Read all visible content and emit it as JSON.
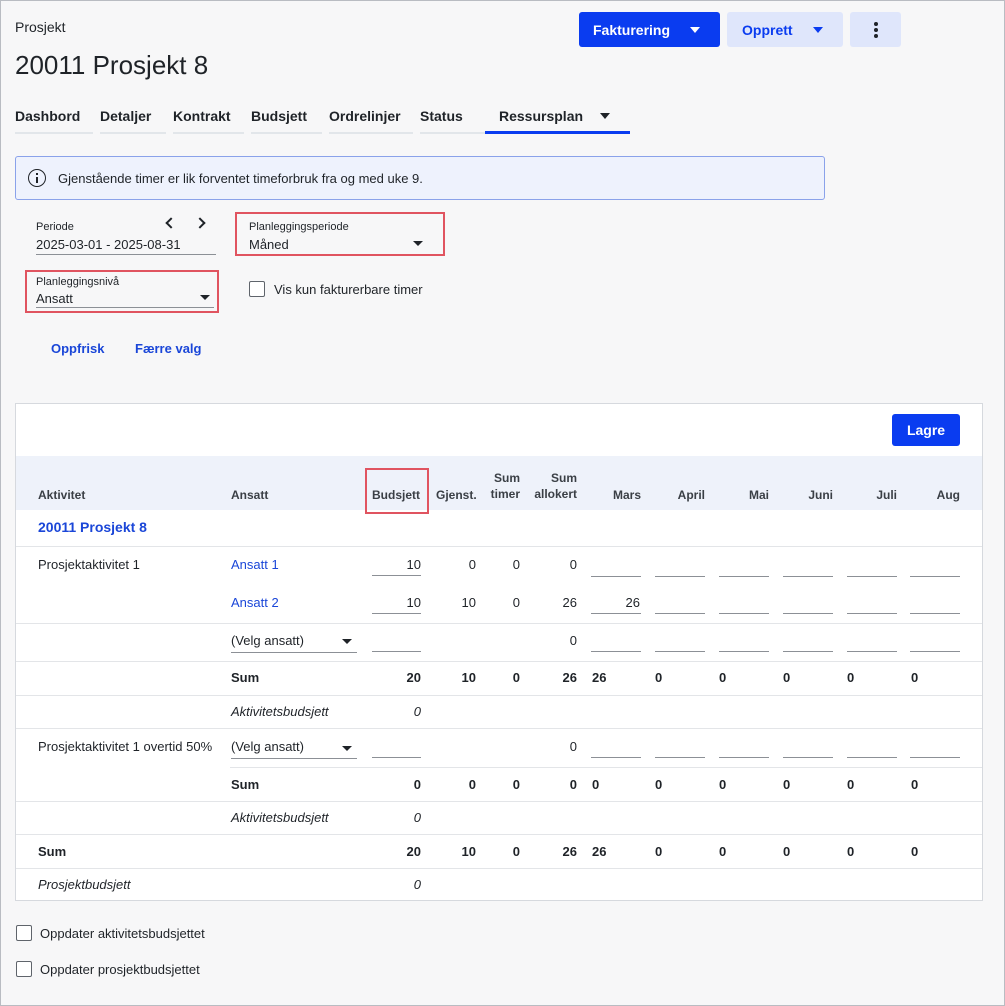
{
  "header": {
    "kicker": "Prosjekt",
    "title": "20011 Prosjekt 8",
    "primary_action": "Fakturering",
    "secondary_action": "Opprett"
  },
  "tabs": [
    "Dashbord",
    "Detaljer",
    "Kontrakt",
    "Budsjett",
    "Ordrelinjer",
    "Status",
    "Ressursplan"
  ],
  "info_banner": "Gjenstående timer er lik forventet timeforbruk fra og med uke 9.",
  "filters": {
    "periode_label": "Periode",
    "periode_value": "2025-03-01 - 2025-08-31",
    "planleggingsperiode_label": "Planleggingsperiode",
    "planleggingsperiode_value": "Måned",
    "planleggingsniva_label": "Planleggingsnivå",
    "planleggingsniva_value": "Ansatt",
    "fakturerbare_label": "Vis kun fakturerbare timer",
    "refresh_label": "Oppfrisk",
    "fewer_label": "Færre valg"
  },
  "table": {
    "save_label": "Lagre",
    "headers": {
      "aktivitet": "Aktivitet",
      "ansatt": "Ansatt",
      "budsjett": "Budsjett",
      "gjenst": "Gjenst.",
      "sum_timer_1": "Sum",
      "sum_timer_2": "timer",
      "sum_allokert_1": "Sum",
      "sum_allokert_2": "allokert",
      "months": [
        "Mars",
        "April",
        "Mai",
        "Juni",
        "Juli",
        "Aug"
      ]
    },
    "project_row": "20011 Prosjekt 8",
    "activity1": {
      "name": "Prosjektaktivitet 1",
      "employee1": {
        "name": "Ansatt 1",
        "budsjett": "10",
        "gjenst": "0",
        "sum_timer": "0",
        "sum_allokert": "0"
      },
      "employee2": {
        "name": "Ansatt 2",
        "budsjett": "10",
        "gjenst": "10",
        "sum_timer": "0",
        "sum_allokert": "26",
        "mars": "26"
      },
      "select_employee": {
        "placeholder": "(Velg ansatt)",
        "sum_allokert": "0"
      },
      "sum": {
        "label": "Sum",
        "budsjett": "20",
        "gjenst": "10",
        "sum_timer": "0",
        "sum_allokert": "26",
        "months": [
          "26",
          "0",
          "0",
          "0",
          "0",
          "0"
        ]
      },
      "budget": {
        "label": "Aktivitetsbudsjett",
        "value": "0"
      }
    },
    "activity2": {
      "name": "Prosjektaktivitet 1 overtid 50%",
      "select_employee": {
        "placeholder": "(Velg ansatt)",
        "sum_allokert": "0"
      },
      "sum": {
        "label": "Sum",
        "budsjett": "0",
        "gjenst": "0",
        "sum_timer": "0",
        "sum_allokert": "0",
        "months": [
          "0",
          "0",
          "0",
          "0",
          "0",
          "0"
        ]
      },
      "budget": {
        "label": "Aktivitetsbudsjett",
        "value": "0"
      }
    },
    "total": {
      "label": "Sum",
      "budsjett": "20",
      "gjenst": "10",
      "sum_timer": "0",
      "sum_allokert": "26",
      "months": [
        "26",
        "0",
        "0",
        "0",
        "0",
        "0"
      ]
    },
    "project_budget": {
      "label": "Prosjektbudsjett",
      "value": "0"
    }
  },
  "footer": {
    "update_activity_budget": "Oppdater aktivitetsbudsjettet",
    "update_project_budget": "Oppdater prosjektbudsjettet"
  }
}
